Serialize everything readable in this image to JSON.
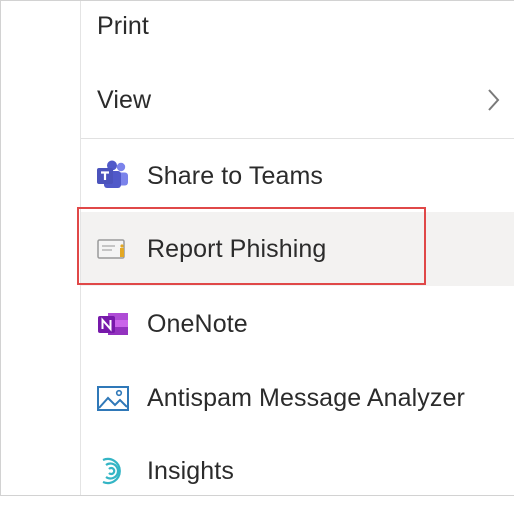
{
  "menu": {
    "items": [
      {
        "key": "print",
        "label": "Print"
      },
      {
        "key": "view",
        "label": "View",
        "has_submenu": true
      },
      {
        "key": "share-to-teams",
        "label": "Share to Teams",
        "icon": "teams-icon"
      },
      {
        "key": "report-phishing",
        "label": "Report Phishing",
        "icon": "report-phishing-icon",
        "hovered": true
      },
      {
        "key": "onenote",
        "label": "OneNote",
        "icon": "onenote-icon"
      },
      {
        "key": "antispam",
        "label": "Antispam Message Analyzer",
        "icon": "image-icon"
      },
      {
        "key": "insights",
        "label": "Insights",
        "icon": "insights-icon"
      }
    ]
  },
  "colors": {
    "teams": "#5059c9",
    "onenote": "#7719aa",
    "antispam": "#2f78b8",
    "insights": "#34b5c5",
    "highlight_border": "#e04848",
    "hover_background": "#f3f2f1"
  }
}
